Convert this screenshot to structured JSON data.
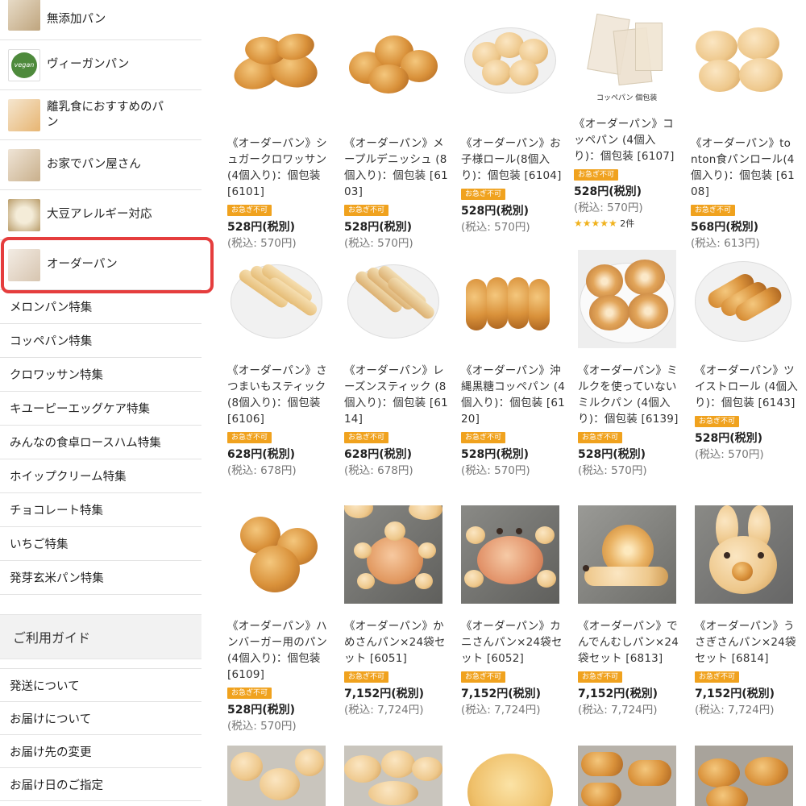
{
  "sidebar": {
    "categories": [
      {
        "label": "無添加パン"
      },
      {
        "label": "ヴィーガンパン",
        "thumb_text": "vegan"
      },
      {
        "label": "離乳食におすすめのパン"
      },
      {
        "label": "お家でパン屋さん"
      },
      {
        "label": "大豆アレルギー対応"
      },
      {
        "label": "オーダーパン"
      }
    ],
    "features": [
      "メロンパン特集",
      "コッペパン特集",
      "クロワッサン特集",
      "キユーピーエッグケア特集",
      "みんなの食卓ロースハム特集",
      "ホイップクリーム特集",
      "チョコレート特集",
      "いちご特集",
      "発芽玄米パン特集"
    ],
    "guide_title": "ご利用ガイド",
    "guide_items": [
      "発送について",
      "お届けについて",
      "お届け先の変更",
      "お届け日のご指定"
    ]
  },
  "products": [
    {
      "name": "《オーダーパン》シュガークロワッサン (4個入り)：個包装 [6101]",
      "badge": "お急ぎ不可",
      "price": "528円(税別)",
      "tax": "(税込: 570円)"
    },
    {
      "name": "《オーダーパン》メープルデニッシュ (8個入り)：個包装 [6103]",
      "badge": "お急ぎ不可",
      "price": "528円(税別)",
      "tax": "(税込: 570円)"
    },
    {
      "name": "《オーダーパン》お子様ロール(8個入り)：個包装 [6104]",
      "badge": "お急ぎ不可",
      "price": "528円(税別)",
      "tax": "(税込: 570円)"
    },
    {
      "name": "《オーダーパン》コッペパン (4個入り)：個包装 [6107]",
      "badge": "お急ぎ不可",
      "price": "528円(税別)",
      "tax": "(税込: 570円)",
      "rating": "★★★★★",
      "rating_count": "2件",
      "img_caption": "コッペパン 個包装"
    },
    {
      "name": "《オーダーパン》tonton食パンロール(4個入り)：個包装 [6108]",
      "badge": "お急ぎ不可",
      "price": "568円(税別)",
      "tax": "(税込: 613円)"
    },
    {
      "name": "《オーダーパン》さつまいもスティック (8個入り)：個包装 [6106]",
      "badge": "お急ぎ不可",
      "price": "628円(税別)",
      "tax": "(税込: 678円)"
    },
    {
      "name": "《オーダーパン》レーズンスティック (8個入り)：個包装 [6114]",
      "badge": "お急ぎ不可",
      "price": "628円(税別)",
      "tax": "(税込: 678円)"
    },
    {
      "name": "《オーダーパン》沖縄黒糖コッペパン (4個入り)：個包装 [6120]",
      "badge": "お急ぎ不可",
      "price": "528円(税別)",
      "tax": "(税込: 570円)"
    },
    {
      "name": "《オーダーパン》ミルクを使っていないミルクパン (4個入り)：個包装 [6139]",
      "badge": "お急ぎ不可",
      "price": "528円(税別)",
      "tax": "(税込: 570円)"
    },
    {
      "name": "《オーダーパン》ツイストロール (4個入り)：個包装 [6143]",
      "badge": "お急ぎ不可",
      "price": "528円(税別)",
      "tax": "(税込: 570円)"
    },
    {
      "name": "《オーダーパン》ハンバーガー用のパン (4個入り)：個包装 [6109]",
      "badge": "お急ぎ不可",
      "price": "528円(税別)",
      "tax": "(税込: 570円)"
    },
    {
      "name": "《オーダーパン》かめさんパン×24袋セット [6051]",
      "badge": "お急ぎ不可",
      "price": "7,152円(税別)",
      "tax": "(税込: 7,724円)"
    },
    {
      "name": "《オーダーパン》カニさんパン×24袋セット [6052]",
      "badge": "お急ぎ不可",
      "price": "7,152円(税別)",
      "tax": "(税込: 7,724円)"
    },
    {
      "name": "《オーダーパン》でんでんむしパン×24袋セット [6813]",
      "badge": "お急ぎ不可",
      "price": "7,152円(税別)",
      "tax": "(税込: 7,724円)"
    },
    {
      "name": "《オーダーパン》うさぎさんパン×24袋セット [6814]",
      "badge": "お急ぎ不可",
      "price": "7,152円(税別)",
      "tax": "(税込: 7,724円)"
    }
  ]
}
